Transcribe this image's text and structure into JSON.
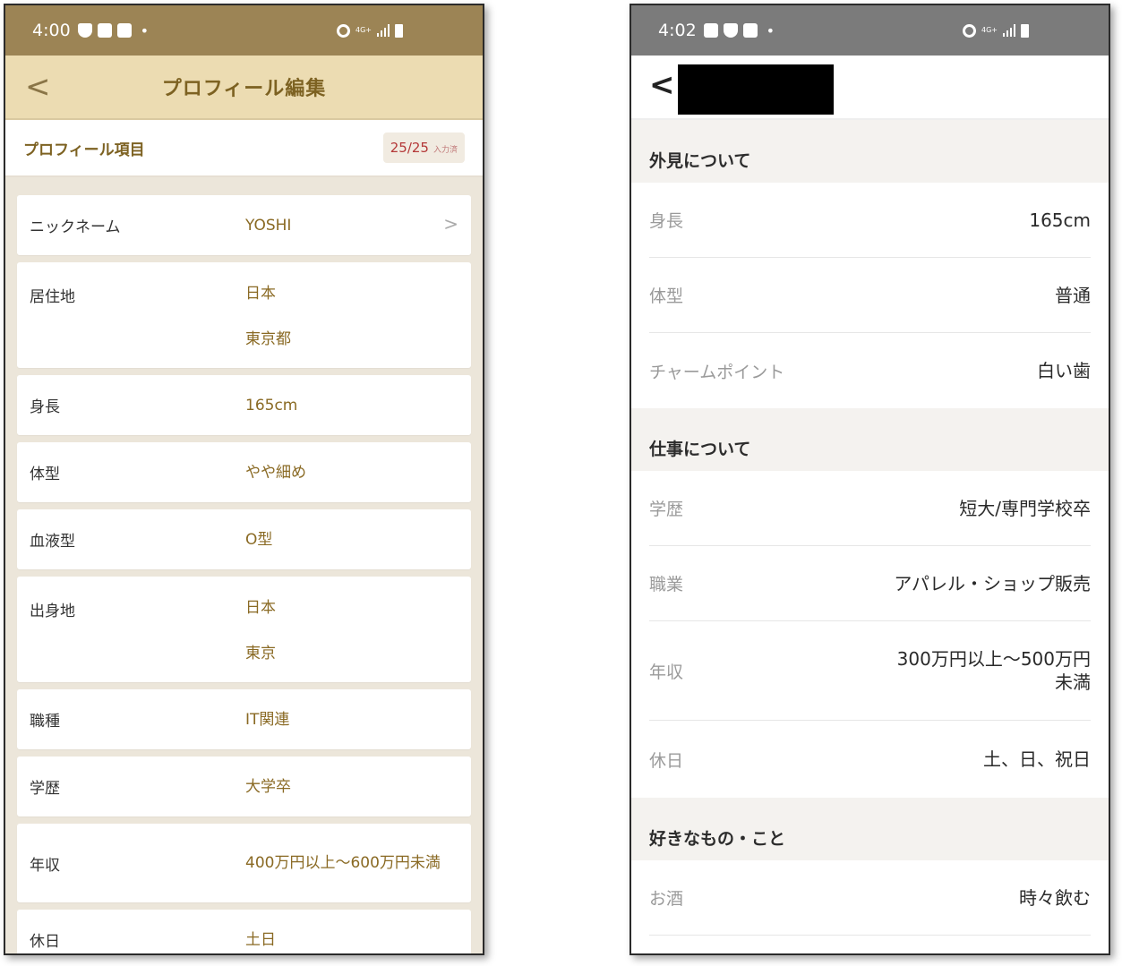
{
  "left": {
    "status": {
      "time": "4:00",
      "net": "4G+"
    },
    "header": {
      "back": "<",
      "title": "プロフィール編集"
    },
    "subbar": {
      "title": "プロフィール項目",
      "count": "25/25",
      "count_suffix": "入力済"
    },
    "items": [
      {
        "label": "ニックネーム",
        "value": "YOSHI",
        "chevron": ">"
      },
      {
        "label": "居住地",
        "value1": "日本",
        "value2": "東京都"
      },
      {
        "label": "身長",
        "value": "165cm"
      },
      {
        "label": "体型",
        "value": "やや細め"
      },
      {
        "label": "血液型",
        "value": "O型"
      },
      {
        "label": "出身地",
        "value1": "日本",
        "value2": "東京"
      },
      {
        "label": "職種",
        "value": "IT関連"
      },
      {
        "label": "学歴",
        "value": "大学卒"
      },
      {
        "label": "年収",
        "value": "400万円以上～600万円未満"
      },
      {
        "label": "休日",
        "value": "土日"
      }
    ]
  },
  "right": {
    "status": {
      "time": "4:02",
      "net": "4G+"
    },
    "header": {
      "back": "<"
    },
    "sections": [
      {
        "title": "外見について",
        "rows": [
          {
            "label": "身長",
            "value": "165cm"
          },
          {
            "label": "体型",
            "value": "普通"
          },
          {
            "label": "チャームポイント",
            "value": "白い歯"
          }
        ]
      },
      {
        "title": "仕事について",
        "rows": [
          {
            "label": "学歴",
            "value": "短大/専門学校卒"
          },
          {
            "label": "職業",
            "value": "アパレル・ショップ販売"
          },
          {
            "label": "年収",
            "value": "300万円以上～500万円",
            "value_line2": "未満"
          },
          {
            "label": "休日",
            "value": "土、日、祝日"
          }
        ]
      },
      {
        "title": "好きなもの・こと",
        "rows": [
          {
            "label": "お酒",
            "value": "時々飲む"
          }
        ]
      }
    ]
  }
}
